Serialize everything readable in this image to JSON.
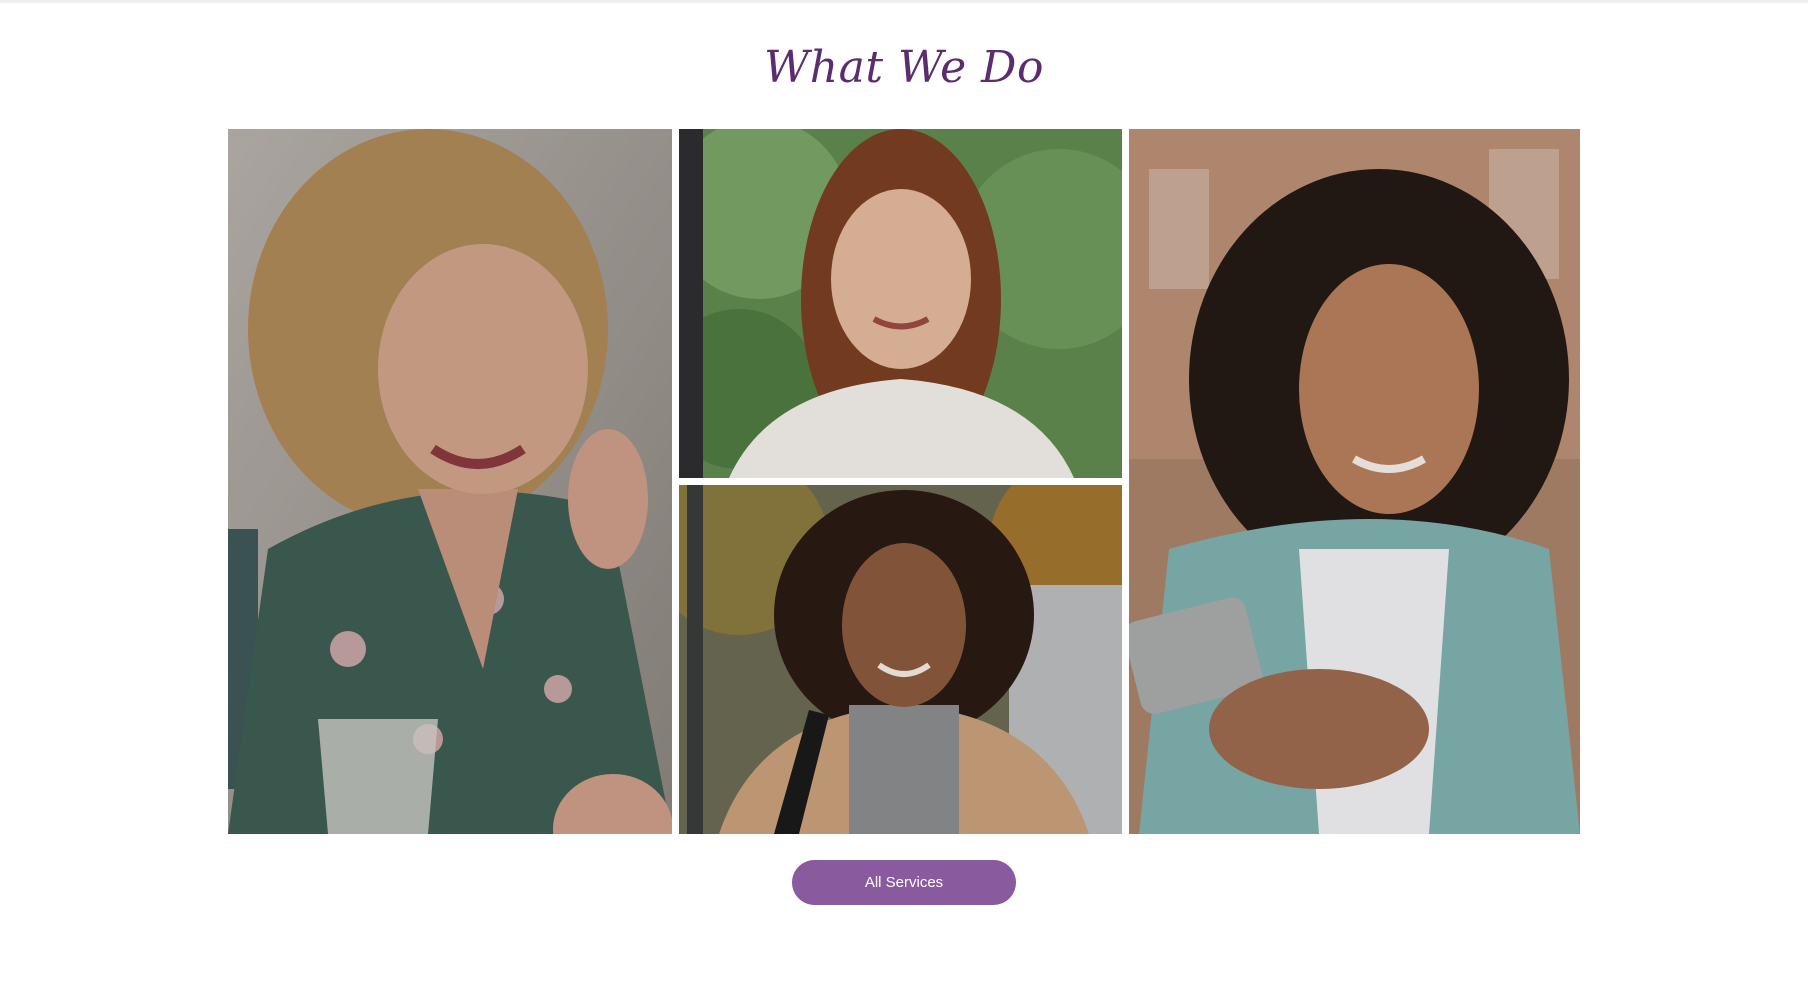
{
  "section": {
    "title": "What We Do",
    "button_label": "All Services",
    "accent_color": "#8a5a9e",
    "title_color": "#5b2d6e"
  },
  "gallery": [
    {
      "name": "photo-woman-floral-dress",
      "icon": "photo"
    },
    {
      "name": "photo-woman-white-blouse",
      "icon": "photo"
    },
    {
      "name": "photo-woman-camel-coat",
      "icon": "photo"
    },
    {
      "name": "photo-woman-holding-phone",
      "icon": "photo"
    }
  ]
}
